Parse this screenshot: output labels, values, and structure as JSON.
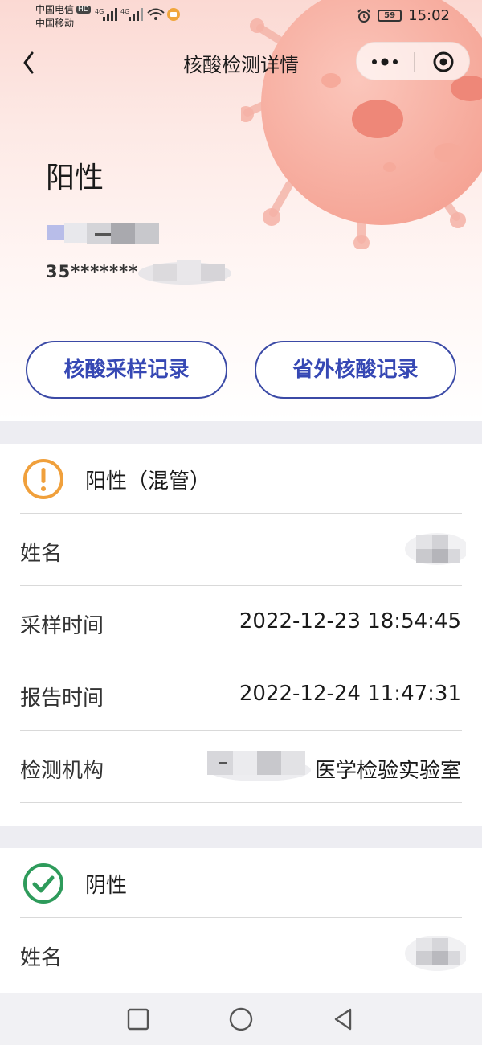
{
  "status_bar": {
    "carrier_1": "中国电信",
    "carrier_1_badge": "HD",
    "carrier_2": "中国移动",
    "network_1": "4G",
    "network_2": "4G",
    "battery": "59",
    "time": "15:02",
    "icons": [
      "signal-icon",
      "wifi-icon",
      "notification-icon",
      "alarm-icon",
      "battery-icon"
    ]
  },
  "navbar": {
    "title": "核酸检测详情",
    "icons": [
      "back-icon",
      "more-icon",
      "close-target-icon"
    ]
  },
  "hero": {
    "result": "阳性",
    "id_number": "35*******"
  },
  "actions": {
    "sampling_records": "核酸采样记录",
    "out_of_province_records": "省外核酸记录"
  },
  "records": [
    {
      "status": "阳性（混管）",
      "status_icon": "warning-icon",
      "status_color": "#f0a03c",
      "fields": [
        {
          "label": "姓名",
          "value": ""
        },
        {
          "label": "采样时间",
          "value": "2022-12-23 18:54:45"
        },
        {
          "label": "报告时间",
          "value": "2022-12-24 11:47:31"
        },
        {
          "label": "检测机构",
          "value": "医学检验实验室"
        }
      ]
    },
    {
      "status": "阴性",
      "status_icon": "check-circle-icon",
      "status_color": "#2e9b5b",
      "fields": [
        {
          "label": "姓名",
          "value": ""
        }
      ]
    }
  ],
  "system_nav": {
    "icons": [
      "square-recent-icon",
      "circle-home-icon",
      "triangle-back-icon"
    ]
  },
  "colors": {
    "accent": "#3648b4",
    "hero_pink": "#fbd9d3",
    "virus": "#f08a78",
    "page_bg": "#ededf2"
  }
}
